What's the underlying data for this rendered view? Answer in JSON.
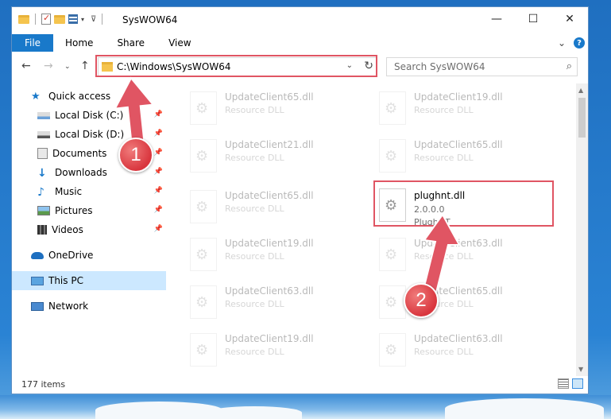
{
  "window": {
    "title": "SysWOW64",
    "controls": {
      "minimize": "—",
      "maximize": "☐",
      "close": "✕"
    }
  },
  "ribbon": {
    "tabs": [
      "File",
      "Home",
      "Share",
      "View"
    ],
    "expand": "⌄",
    "help": "?"
  },
  "address": {
    "path": "C:\\Windows\\SysWOW64",
    "search_placeholder": "Search SysWOW64"
  },
  "nav": {
    "items": [
      {
        "label": "Quick access",
        "icon": "star-icon"
      },
      {
        "label": "Local Disk (C:)",
        "icon": "drive-icon",
        "pinned": true
      },
      {
        "label": "Local Disk (D:)",
        "icon": "drive-icon",
        "pinned": true
      },
      {
        "label": "Documents",
        "icon": "documents-icon",
        "pinned": true
      },
      {
        "label": "Downloads",
        "icon": "downloads-icon",
        "pinned": true
      },
      {
        "label": "Music",
        "icon": "music-icon",
        "pinned": true
      },
      {
        "label": "Pictures",
        "icon": "pictures-icon",
        "pinned": true
      },
      {
        "label": "Videos",
        "icon": "videos-icon",
        "pinned": true
      },
      {
        "label": "OneDrive",
        "icon": "onedrive-icon"
      },
      {
        "label": "This PC",
        "icon": "this-pc-icon",
        "selected": true
      },
      {
        "label": "Network",
        "icon": "network-icon"
      }
    ]
  },
  "files": {
    "left": [
      {
        "name": "UpdateClient65.dll",
        "type": "Resource DLL"
      },
      {
        "name": "UpdateClient21.dll",
        "type": "Resource DLL"
      },
      {
        "name": "UpdateClient65.dll",
        "type": "Resource DLL"
      },
      {
        "name": "UpdateClient19.dll",
        "type": "Resource DLL"
      },
      {
        "name": "UpdateClient63.dll",
        "type": "Resource DLL"
      },
      {
        "name": "UpdateClient19.dll",
        "type": "Resource DLL"
      }
    ],
    "right": [
      {
        "name": "UpdateClient19.dll",
        "type": "Resource DLL"
      },
      {
        "name": "UpdateClient65.dll",
        "type": "Resource DLL"
      },
      {
        "name": "plughnt.dll",
        "version": "2.0.0.0",
        "company": "PlughNT",
        "highlight": true
      },
      {
        "name": "UpdateClient63.dll",
        "type": "Resource DLL"
      },
      {
        "name": "UpdateClient65.dll",
        "type": "Resource DLL"
      },
      {
        "name": "UpdateClient63.dll",
        "type": "Resource DLL"
      }
    ]
  },
  "status": {
    "items": "177 items"
  },
  "annotations": {
    "step1": "1",
    "step2": "2"
  },
  "colors": {
    "accent": "#1979ca",
    "highlight": "#e05563",
    "selected": "#cce8ff"
  }
}
